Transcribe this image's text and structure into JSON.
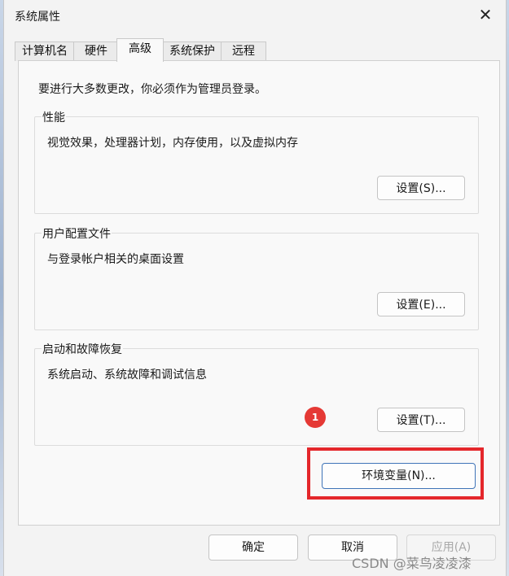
{
  "window": {
    "title": "系统属性",
    "close_symbol": "✕"
  },
  "tabs": [
    {
      "label": "计算机名"
    },
    {
      "label": "硬件"
    },
    {
      "label": "高级",
      "active": true
    },
    {
      "label": "系统保护"
    },
    {
      "label": "远程"
    }
  ],
  "advanced": {
    "notice": "要进行大多数更改，你必须作为管理员登录。",
    "performance": {
      "title": "性能",
      "description": "视觉效果，处理器计划，内存使用，以及虚拟内存",
      "button": "设置(S)..."
    },
    "user_profiles": {
      "title": "用户配置文件",
      "description": "与登录帐户相关的桌面设置",
      "button": "设置(E)..."
    },
    "startup_recovery": {
      "title": "启动和故障恢复",
      "description": "系统启动、系统故障和调试信息",
      "button": "设置(T)..."
    },
    "env_button": "环境变量(N)..."
  },
  "annotation": {
    "badge": "1",
    "highlight_color": "#e4272b"
  },
  "footer": {
    "ok": "确定",
    "cancel": "取消",
    "apply": "应用(A)"
  },
  "watermark": "CSDN @菜鸟凌凌漆"
}
